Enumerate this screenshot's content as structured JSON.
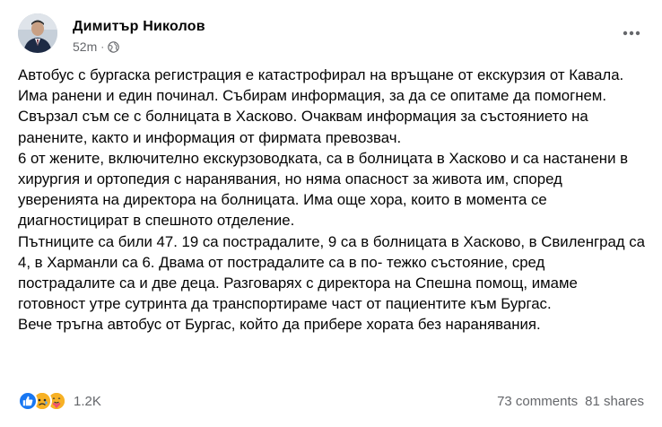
{
  "post": {
    "author": "Димитър Николов",
    "time": "52m",
    "separator": "·",
    "privacy_icon": "globe-icon",
    "more_icon": "more-horizontal-icon",
    "paragraphs": [
      "Автобус с бургаска регистрация е катастрофирал на връщане от екскурзия от Кавала. Има ранени и един починал. Събирам информация, за да се опитаме да помогнем. Свързал съм се с болницата в Хасково. Очаквам информация за състоянието на ранените, както и информация от фирмата превозвач.",
      "6 от жените, включително екскурзоводката, са в болницата в Хасково и са настанени в хирургия и ортопедия с наранявания, но няма опасност за живота им, според уверенията на директора на болницата. Има още хора, които в момента се диагностицират в спешното отделение.",
      "Пътниците са били 47. 19 са пострадалите, 9 са в болницата в Хасково, в Свиленград са 4, в Харманли са 6. Двама от пострадалите са в по- тежко състояние, сред пострадалите са и две деца. Разговарях с директора на Спешна помощ, имаме готовност утре сутринта да транспортираме част от пациентите към Бургас.",
      "Вече тръгна автобус от Бургас, който да прибере хората без наранявания."
    ]
  },
  "footer": {
    "reaction_icons": [
      "like-icon",
      "sad-icon",
      "care-icon"
    ],
    "reaction_count": "1.2K",
    "comments": "73 comments",
    "shares": "81 shares"
  },
  "colors": {
    "text": "#050505",
    "secondary": "#65676b",
    "like": "#1877f2",
    "emoji": "#f7b125"
  }
}
